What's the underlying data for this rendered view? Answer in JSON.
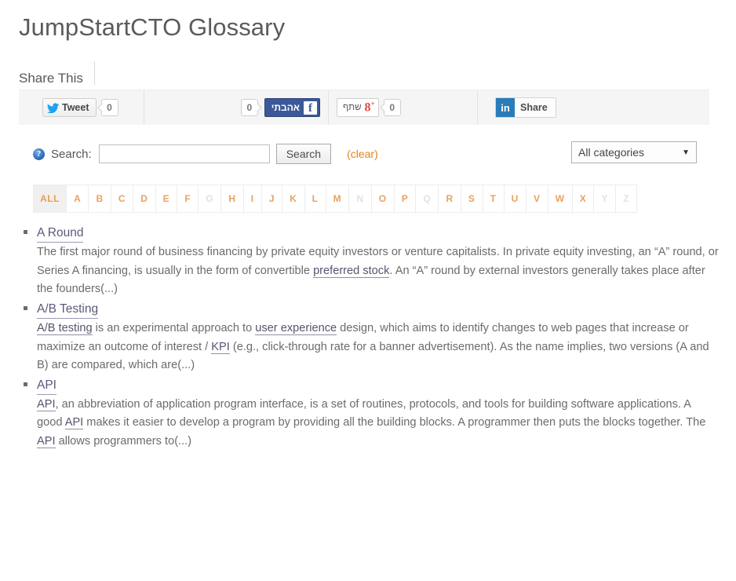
{
  "page_title": "JumpStartCTO Glossary",
  "share": {
    "heading": "Share This",
    "twitter": {
      "label": "Tweet",
      "count": "0",
      "icon": "twitter-bird-icon"
    },
    "facebook": {
      "label": "אהבתי",
      "count": "0",
      "icon": "facebook-f-icon"
    },
    "googleplus": {
      "label": "שתף",
      "count": "0",
      "icon": "google-plus-icon"
    },
    "linkedin": {
      "label": "Share",
      "icon": "linkedin-in-icon"
    }
  },
  "search": {
    "help_icon": "help-question-icon",
    "label": "Search:",
    "value": "",
    "placeholder": "",
    "button": "Search",
    "clear": "(clear)",
    "category_selected": "All categories",
    "caret": "▼"
  },
  "alphabet": [
    {
      "label": "ALL",
      "active": true,
      "disabled": false
    },
    {
      "label": "A",
      "active": false,
      "disabled": false
    },
    {
      "label": "B",
      "active": false,
      "disabled": false
    },
    {
      "label": "C",
      "active": false,
      "disabled": false
    },
    {
      "label": "D",
      "active": false,
      "disabled": false
    },
    {
      "label": "E",
      "active": false,
      "disabled": false
    },
    {
      "label": "F",
      "active": false,
      "disabled": false
    },
    {
      "label": "G",
      "active": false,
      "disabled": true
    },
    {
      "label": "H",
      "active": false,
      "disabled": false
    },
    {
      "label": "I",
      "active": false,
      "disabled": false
    },
    {
      "label": "J",
      "active": false,
      "disabled": false
    },
    {
      "label": "K",
      "active": false,
      "disabled": false
    },
    {
      "label": "L",
      "active": false,
      "disabled": false
    },
    {
      "label": "M",
      "active": false,
      "disabled": false
    },
    {
      "label": "N",
      "active": false,
      "disabled": true
    },
    {
      "label": "O",
      "active": false,
      "disabled": false
    },
    {
      "label": "P",
      "active": false,
      "disabled": false
    },
    {
      "label": "Q",
      "active": false,
      "disabled": true
    },
    {
      "label": "R",
      "active": false,
      "disabled": false
    },
    {
      "label": "S",
      "active": false,
      "disabled": false
    },
    {
      "label": "T",
      "active": false,
      "disabled": false
    },
    {
      "label": "U",
      "active": false,
      "disabled": false
    },
    {
      "label": "V",
      "active": false,
      "disabled": false
    },
    {
      "label": "W",
      "active": false,
      "disabled": false
    },
    {
      "label": "X",
      "active": false,
      "disabled": false
    },
    {
      "label": "Y",
      "active": false,
      "disabled": true
    },
    {
      "label": "Z",
      "active": false,
      "disabled": true
    }
  ],
  "entries": [
    {
      "term": "A Round",
      "body_parts": [
        {
          "text": "The first major round of business financing by private equity investors or venture capitalists. In private equity investing, an “A” round, or Series A financing, is usually in the form of convertible ",
          "link": false
        },
        {
          "text": "preferred stock",
          "link": true
        },
        {
          "text": ". An “A” round by external investors generally takes place after the founders(...)",
          "link": false
        }
      ]
    },
    {
      "term": "A/B Testing",
      "body_parts": [
        {
          "text": "A/B testing",
          "link": true
        },
        {
          "text": " is an experimental approach to ",
          "link": false
        },
        {
          "text": "user experience",
          "link": true
        },
        {
          "text": " design, which aims to identify changes to web pages that increase or maximize an outcome of interest / ",
          "link": false
        },
        {
          "text": "KPI",
          "link": true
        },
        {
          "text": " (e.g., click-through rate for a banner advertisement). As the name implies, two versions (A and B) are compared, which are(...)",
          "link": false
        }
      ]
    },
    {
      "term": "API",
      "body_parts": [
        {
          "text": "API",
          "link": true
        },
        {
          "text": ", an abbreviation of application program interface, is a set of routines, protocols, and tools for building software applications. A good ",
          "link": false
        },
        {
          "text": "API",
          "link": true
        },
        {
          "text": " makes it easier to develop a program by providing all the building blocks. A programmer then puts the blocks together. The ",
          "link": false
        },
        {
          "text": "API",
          "link": true
        },
        {
          "text": " allows programmers to(...)",
          "link": false
        }
      ]
    }
  ],
  "colors": {
    "accent_orange": "#e3821c",
    "alpha_orange": "#e8a260",
    "link_purple": "#5a5a7a",
    "text_gray": "#6b6b6b",
    "facebook_blue": "#3b5998",
    "twitter_blue": "#1da1f2",
    "linkedin_blue": "#2a7bb9",
    "googleplus_red": "#dd4b39"
  }
}
